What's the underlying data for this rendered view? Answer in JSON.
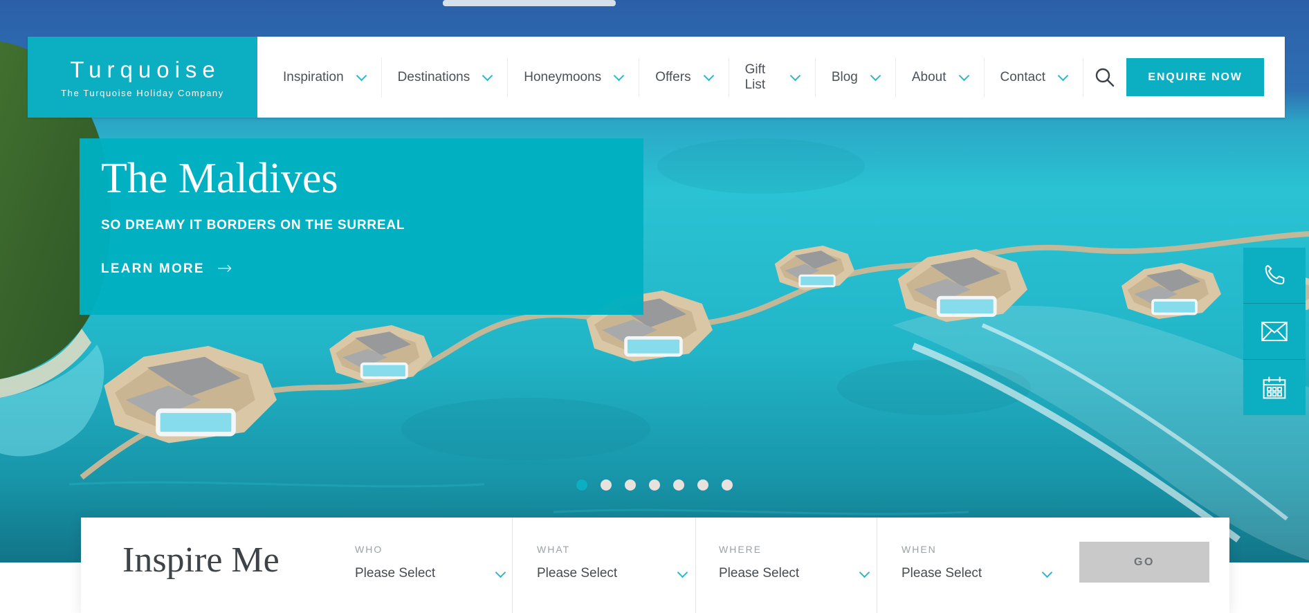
{
  "brand": {
    "name": "Turquoise",
    "tagline": "The Turquoise Holiday Company"
  },
  "header": {
    "nav_items": [
      {
        "label": "Inspiration"
      },
      {
        "label": "Destinations"
      },
      {
        "label": "Honeymoons"
      },
      {
        "label": "Offers"
      },
      {
        "label": "Gift List"
      },
      {
        "label": "Blog"
      },
      {
        "label": "About"
      },
      {
        "label": "Contact"
      }
    ],
    "enquire_label": "ENQUIRE NOW"
  },
  "hero": {
    "title": "The Maldives",
    "subtitle": "SO DREAMY IT BORDERS ON THE SURREAL",
    "cta_label": "LEARN MORE",
    "cta_arrow": "→"
  },
  "carousel": {
    "total_slides": 7,
    "active_slide": 1
  },
  "contact_rail": {
    "icons": [
      "phone-icon",
      "email-icon",
      "calendar-icon"
    ]
  },
  "inspire": {
    "heading": "Inspire Me",
    "fields": [
      {
        "label": "WHO",
        "value": "Please Select"
      },
      {
        "label": "WHAT",
        "value": "Please Select"
      },
      {
        "label": "WHERE",
        "value": "Please Select"
      },
      {
        "label": "WHEN",
        "value": "Please Select"
      }
    ],
    "go_label": "GO"
  },
  "colors": {
    "brand_teal": "#0caec2",
    "overlay_teal": "#00b0c0",
    "water_turquoise": "#29c2d3",
    "dot_inactive": "#e7e2de",
    "go_gray": "#c9c9c9"
  }
}
